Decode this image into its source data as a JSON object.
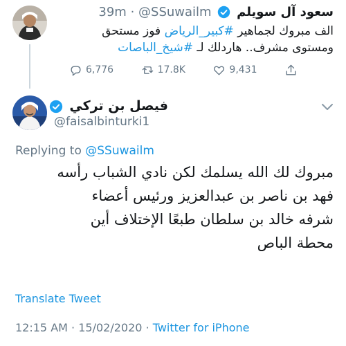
{
  "parent_tweet": {
    "display_name": "سعود آل سويلم",
    "handle": "@SSuwailm",
    "separator": "·",
    "time": "39m",
    "text_parts": [
      "الف مبروك لجماهير ",
      "#كبير_الرياض",
      " فوز مستحق ومستوى مشرف.. هاردلك لـ ",
      "#شيخ_الباصات"
    ],
    "stats": {
      "replies": "6,776",
      "retweets": "17.8K",
      "likes": "9,431"
    }
  },
  "main_tweet": {
    "display_name": "فيصل بن تركي",
    "handle": "@faisalbinturki1",
    "replying_prefix": "Replying to ",
    "replying_to": "@SSuwailm",
    "lines": [
      "مبروك لك الله يسلمك لكن نادي الشباب رأسه",
      "فهد بن ناصر بن عبدالعزيز ورئيس أعضاء",
      "شرفه خالد بن سلطان طبعًا الإختلاف أين",
      "محطة الباص"
    ],
    "translate_label": "Translate Tweet",
    "timestamp": "12:15 AM · 15/02/2020 · ",
    "source": "Twitter for iPhone"
  },
  "colors": {
    "link": "#1b95e0",
    "muted": "#657786",
    "verified": "#1da1f2",
    "text": "#14171a"
  },
  "icons": [
    "verified-badge-icon",
    "reply-icon",
    "retweet-icon",
    "like-icon",
    "share-icon",
    "chevron-down-icon"
  ]
}
